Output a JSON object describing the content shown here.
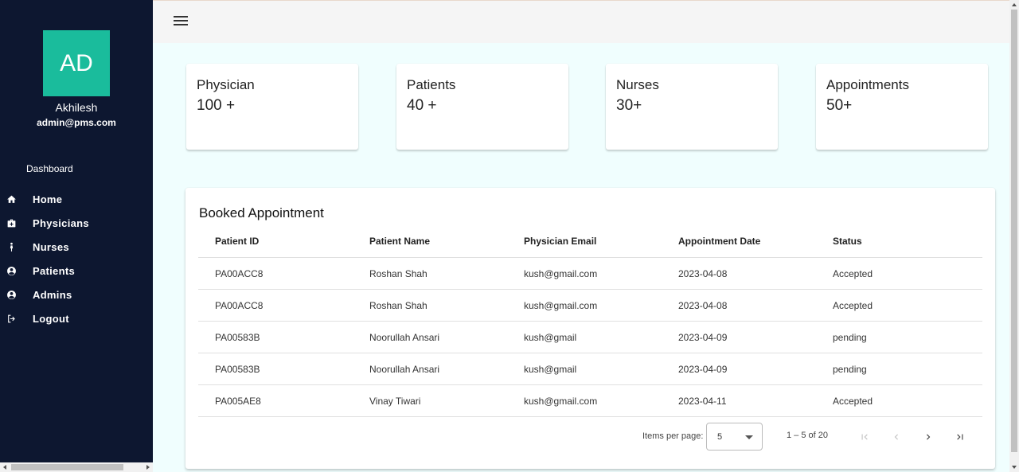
{
  "user": {
    "initials": "AD",
    "name": "Akhilesh",
    "email": "admin@pms.com"
  },
  "nav": {
    "heading": "Dashboard",
    "items": [
      {
        "label": "Home",
        "icon": "home-icon"
      },
      {
        "label": "Physicians",
        "icon": "medical-bag-icon"
      },
      {
        "label": "Nurses",
        "icon": "person-icon"
      },
      {
        "label": "Patients",
        "icon": "account-circle-icon"
      },
      {
        "label": "Admins",
        "icon": "account-circle-icon"
      },
      {
        "label": "Logout",
        "icon": "logout-icon"
      }
    ]
  },
  "stats": [
    {
      "title": "Physician",
      "value": "100 +"
    },
    {
      "title": "Patients",
      "value": "40 +"
    },
    {
      "title": "Nurses",
      "value": "30+"
    },
    {
      "title": "Appointments",
      "value": "50+"
    }
  ],
  "table": {
    "title": "Booked Appointment",
    "columns": [
      "Patient ID",
      "Patient Name",
      "Physician Email",
      "Appointment Date",
      "Status"
    ],
    "rows": [
      [
        "PA00ACC8",
        "Roshan Shah",
        "kush@gmail.com",
        "2023-04-08",
        "Accepted"
      ],
      [
        "PA00ACC8",
        "Roshan Shah",
        "kush@gmail.com",
        "2023-04-08",
        "Accepted"
      ],
      [
        "PA00583B",
        "Noorullah Ansari",
        "kush@gmail",
        "2023-04-09",
        "pending"
      ],
      [
        "PA00583B",
        "Noorullah Ansari",
        "kush@gmail",
        "2023-04-09",
        "pending"
      ],
      [
        "PA005AE8",
        "Vinay Tiwari",
        "kush@gmail.com",
        "2023-04-11",
        "Accepted"
      ]
    ]
  },
  "paginator": {
    "items_per_page_label": "Items per page:",
    "page_size": "5",
    "range_label": "1 – 5 of 20"
  },
  "colors": {
    "sidebar_bg": "#0d1730",
    "avatar_bg": "#1abc9c",
    "content_bg": "#f0fefe"
  }
}
